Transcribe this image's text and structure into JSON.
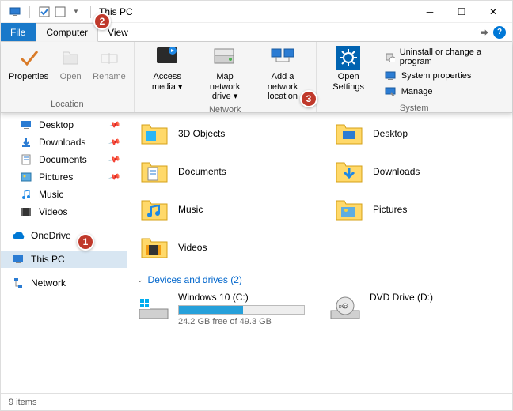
{
  "window": {
    "title": "This PC"
  },
  "tabs": {
    "file": "File",
    "computer": "Computer",
    "view": "View"
  },
  "ribbon": {
    "location": {
      "label": "Location",
      "properties": "Properties",
      "open": "Open",
      "rename": "Rename"
    },
    "network": {
      "label": "Network",
      "access_media": "Access media ▾",
      "map_drive": "Map network drive ▾",
      "add_location": "Add a network location"
    },
    "system": {
      "label": "System",
      "open_settings": "Open Settings",
      "uninstall": "Uninstall or change a program",
      "system_properties": "System properties",
      "manage": "Manage"
    }
  },
  "sidebar": {
    "desktop": "Desktop",
    "downloads": "Downloads",
    "documents": "Documents",
    "pictures": "Pictures",
    "music": "Music",
    "videos": "Videos",
    "onedrive": "OneDrive",
    "thispc": "This PC",
    "network": "Network"
  },
  "folders": {
    "objects3d": "3D Objects",
    "desktop": "Desktop",
    "documents": "Documents",
    "downloads": "Downloads",
    "music": "Music",
    "pictures": "Pictures",
    "videos": "Videos"
  },
  "devices": {
    "header": "Devices and drives (2)",
    "c": {
      "name": "Windows 10 (C:)",
      "free": "24.2 GB free of 49.3 GB"
    },
    "d": {
      "name": "DVD Drive (D:)"
    }
  },
  "status": {
    "items": "9 items"
  },
  "annot": {
    "a1": "1",
    "a2": "2",
    "a3": "3"
  }
}
